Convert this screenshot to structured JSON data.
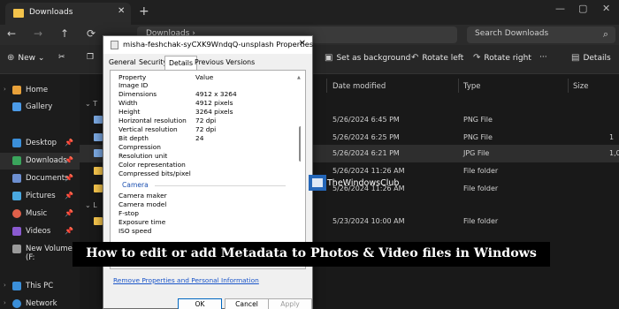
{
  "explorer": {
    "tab_label": "Downloads",
    "tab_close": "✕",
    "tab_add": "+",
    "window_controls": [
      "—",
      "▢",
      "✕"
    ],
    "nav_icons": [
      "←",
      "→",
      "↑",
      "⟳"
    ],
    "address": "Downloads  ›",
    "search_placeholder": "Search Downloads",
    "toolbar": {
      "new_label": "New",
      "set_as_background_label": "Set as background",
      "rotate_left_label": "Rotate left",
      "rotate_right_label": "Rotate right",
      "more_label": "···",
      "details_label": "Details"
    },
    "sidebar": [
      {
        "label": "Home",
        "icon": "home-icon",
        "color": "#e8a13a",
        "pinned": false
      },
      {
        "label": "Gallery",
        "icon": "gallery-icon",
        "color": "#4c9be8",
        "pinned": false
      },
      {
        "label": "Desktop",
        "icon": "desktop-icon",
        "color": "#3b8fd9",
        "pinned": true
      },
      {
        "label": "Downloads",
        "icon": "downloads-icon",
        "color": "#3aa45c",
        "pinned": true
      },
      {
        "label": "Documents",
        "icon": "documents-icon",
        "color": "#6d8fd0",
        "pinned": true
      },
      {
        "label": "Pictures",
        "icon": "pictures-icon",
        "color": "#4aa8e0",
        "pinned": true
      },
      {
        "label": "Music",
        "icon": "music-icon",
        "color": "#e0604a",
        "pinned": true
      },
      {
        "label": "Videos",
        "icon": "videos-icon",
        "color": "#8a5ad0",
        "pinned": true
      },
      {
        "label": "New Volume (F:",
        "icon": "drive-icon",
        "color": "#9a9a9a",
        "pinned": false
      },
      {
        "label": "This PC",
        "icon": "pc-icon",
        "color": "#3b8fd9",
        "pinned": false
      },
      {
        "label": "Network",
        "icon": "network-icon",
        "color": "#3b8fd9",
        "pinned": false
      }
    ],
    "columns": {
      "date_modified": "Date modified",
      "type": "Type",
      "size": "Size"
    },
    "rows": [
      {
        "date": "5/26/2024 6:45 PM",
        "type": "PNG File",
        "size": "",
        "icon_color": "#7aa7e0"
      },
      {
        "date": "5/26/2024 6:25 PM",
        "type": "PNG File",
        "size": "1",
        "icon_color": "#7aa7e0"
      },
      {
        "date": "5/26/2024 6:21 PM",
        "type": "JPG File",
        "size": "1,0",
        "icon_color": "#7aa7e0"
      },
      {
        "date": "5/26/2024 11:26 AM",
        "type": "File folder",
        "size": "",
        "icon_color": "#f3c34b"
      },
      {
        "date": "5/26/2024 11:26 AM",
        "type": "File folder",
        "size": "",
        "icon_color": "#f3c34b"
      },
      {
        "date": "",
        "type": "",
        "size": "",
        "icon_color": "#f3c34b"
      },
      {
        "date": "5/23/2024 10:00 AM",
        "type": "File folder",
        "size": "",
        "icon_color": "#f3c34b"
      }
    ]
  },
  "dialog": {
    "title": "misha-feshchak-syCXK9WndqQ-unsplash Properties",
    "close": "✕",
    "tabs": [
      "General",
      "Security",
      "Details",
      "Previous Versions"
    ],
    "header": {
      "property": "Property",
      "value": "Value"
    },
    "image_rows": [
      {
        "k": "Image ID",
        "v": ""
      },
      {
        "k": "Dimensions",
        "v": "4912 x 3264"
      },
      {
        "k": "Width",
        "v": "4912 pixels"
      },
      {
        "k": "Height",
        "v": "3264 pixels"
      },
      {
        "k": "Horizontal resolution",
        "v": "72 dpi"
      },
      {
        "k": "Vertical resolution",
        "v": "72 dpi"
      },
      {
        "k": "Bit depth",
        "v": "24"
      },
      {
        "k": "Compression",
        "v": ""
      },
      {
        "k": "Resolution unit",
        "v": ""
      },
      {
        "k": "Color representation",
        "v": ""
      },
      {
        "k": "Compressed bits/pixel",
        "v": ""
      }
    ],
    "camera_section": "Camera",
    "camera_rows": [
      {
        "k": "Camera maker",
        "v": ""
      },
      {
        "k": "Camera model",
        "v": ""
      },
      {
        "k": "F-stop",
        "v": ""
      },
      {
        "k": "Exposure time",
        "v": ""
      },
      {
        "k": "ISO speed",
        "v": ""
      }
    ],
    "remove_link": "Remove Properties and Personal Information",
    "buttons": {
      "ok": "OK",
      "cancel": "Cancel",
      "apply": "Apply"
    }
  },
  "overlay": {
    "brand": "TheWindowsClub",
    "banner": "How to edit or add Metadata to Photos & Video files in Windows"
  }
}
